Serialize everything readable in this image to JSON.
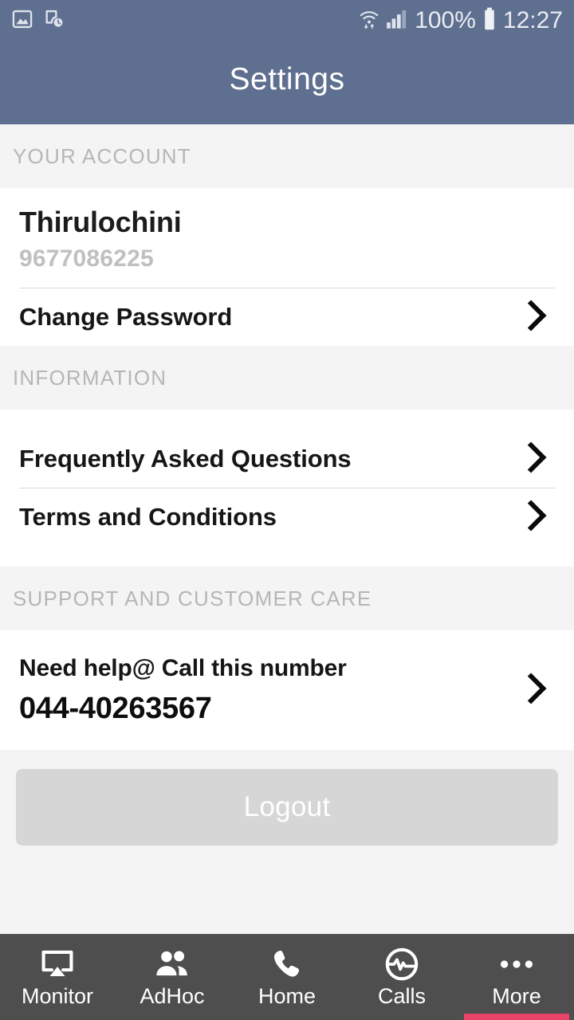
{
  "statusbar": {
    "left_icons": [
      "image-icon",
      "phone-clock-icon"
    ],
    "right_icons": [
      "wifi-icon",
      "signal-bars-icon",
      "battery-icon"
    ],
    "battery_percent": "100%",
    "time": "12:27"
  },
  "appbar": {
    "title": "Settings",
    "background_color": "#5f6f90"
  },
  "sections": [
    {
      "header": "YOUR ACCOUNT",
      "account": {
        "name": "Thirulochini",
        "phone": "9677086225"
      },
      "rows": [
        {
          "label": "Change Password",
          "chevron": "chevron-right-icon"
        }
      ]
    },
    {
      "header": "INFORMATION",
      "rows": [
        {
          "label": "Frequently Asked Questions",
          "chevron": "chevron-right-icon"
        },
        {
          "label": "Terms and Conditions",
          "chevron": "chevron-right-icon"
        }
      ]
    },
    {
      "header": "SUPPORT AND CUSTOMER CARE",
      "support": {
        "line1": "Need help@ Call this number",
        "number": "044-40263567",
        "chevron": "chevron-right-icon"
      }
    }
  ],
  "logout": {
    "label": "Logout",
    "background_color": "#d6d6d6"
  },
  "bottomnav": {
    "background_color": "#4e4e4e",
    "active_indicator_color": "#e8446a",
    "active_index": 4,
    "items": [
      {
        "label": "Monitor",
        "icon": "cast-screen-icon"
      },
      {
        "label": "AdHoc",
        "icon": "people-icon"
      },
      {
        "label": "Home",
        "icon": "phone-handset-icon"
      },
      {
        "label": "Calls",
        "icon": "pulse-circle-icon"
      },
      {
        "label": "More",
        "icon": "ellipsis-icon"
      }
    ]
  }
}
